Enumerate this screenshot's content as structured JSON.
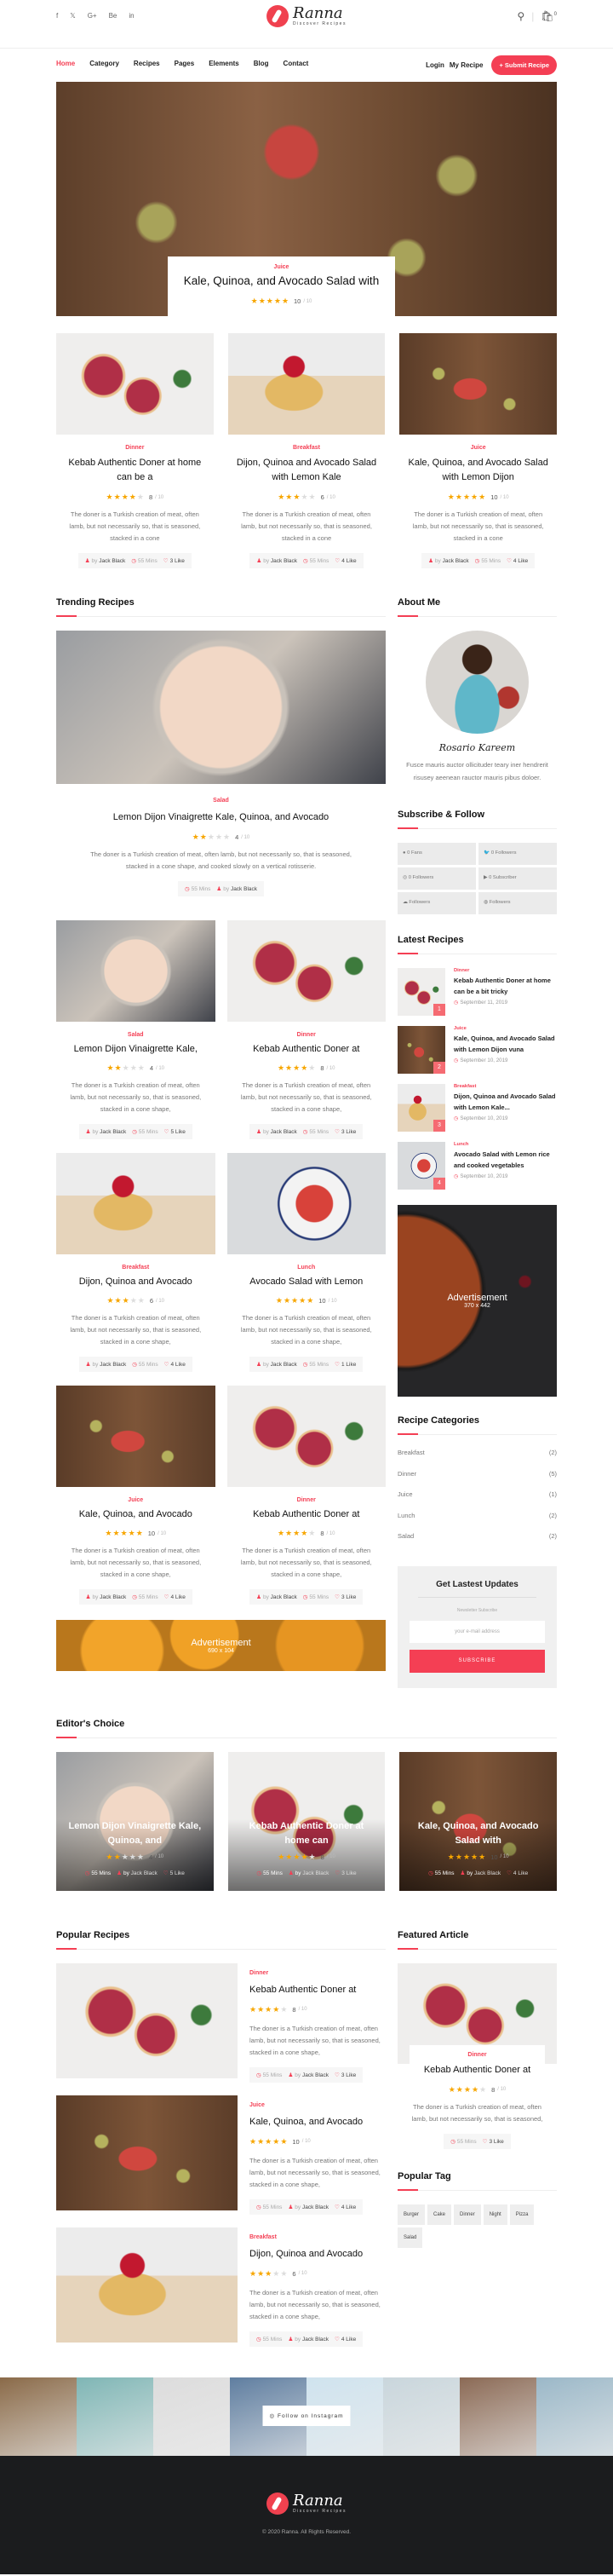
{
  "header": {
    "social": [
      "f",
      "𝕏",
      "G+",
      "Be",
      "in"
    ],
    "logo": {
      "name": "Ranna",
      "tagline": "Discover Recipes"
    },
    "search_icon": "search-icon",
    "cart_count": "0"
  },
  "nav": {
    "items": [
      "Home",
      "Category",
      "Recipes",
      "Pages",
      "Elements",
      "Blog",
      "Contact"
    ],
    "login": "Login",
    "my_recipe": "My Recipe",
    "submit": "Submit Recipe"
  },
  "common": {
    "by": "by",
    "author": "Jack Black",
    "time": "55 Mins",
    "rating_max": "/ 10"
  },
  "colors": {
    "accent": "#f43f54",
    "star": "#f7a600",
    "footer": "#1b1c1e"
  },
  "hero": {
    "category": "Juice",
    "title": "Kale, Quinoa, and Avocado Salad with",
    "rating": 10
  },
  "top_cards": [
    {
      "img": "pie",
      "category": "Dinner",
      "title": "Kebab Authentic Doner at home can be a",
      "rating": 8,
      "desc": "The doner is a Turkish creation of meat, often lamb, but not necessarily so, that is seasoned, stacked in a cone",
      "likes": "3 Like"
    },
    {
      "img": "waffle",
      "category": "Breakfast",
      "title": "Dijon, Quinoa and Avocado Salad with Lemon Kale",
      "rating": 6,
      "desc": "The doner is a Turkish creation of meat, often lamb, but not necessarily so, that is seasoned, stacked in a cone",
      "likes": "4 Like"
    },
    {
      "img": "juice",
      "category": "Juice",
      "title": "Kale, Quinoa, and Avocado Salad with Lemon Dijon",
      "rating": 10,
      "desc": "The doner is a Turkish creation of meat, often lamb, but not necessarily so, that is seasoned, stacked in a cone",
      "likes": "4 Like"
    }
  ],
  "trending": {
    "heading": "Trending Recipes",
    "main": {
      "img": "mac",
      "category": "Salad",
      "title": "Lemon Dijon Vinaigrette Kale, Quinoa, and Avocado",
      "rating": 4,
      "desc": "The doner is a Turkish creation of meat, often lamb, but not necessarily so, that is seasoned, stacked in a cone shape, and cooked slowly on a vertical rotisserie."
    },
    "grid": [
      {
        "img": "mac",
        "category": "Salad",
        "title": "Lemon Dijon Vinaigrette Kale,",
        "rating": 4,
        "desc": "The doner is a Turkish creation of meat, often lamb, but not necessarily so, that is seasoned, stacked in a cone shape,",
        "likes": "5 Like"
      },
      {
        "img": "pie",
        "category": "Dinner",
        "title": "Kebab Authentic Doner at",
        "rating": 8,
        "desc": "The doner is a Turkish creation of meat, often lamb, but not necessarily so, that is seasoned, stacked in a cone shape,",
        "likes": "3 Like"
      },
      {
        "img": "waffle",
        "category": "Breakfast",
        "title": "Dijon, Quinoa and Avocado",
        "rating": 6,
        "desc": "The doner is a Turkish creation of meat, often lamb, but not necessarily so, that is seasoned, stacked in a cone shape,",
        "likes": "4 Like"
      },
      {
        "img": "salad",
        "category": "Lunch",
        "title": "Avocado Salad with Lemon",
        "rating": 10,
        "desc": "The doner is a Turkish creation of meat, often lamb, but not necessarily so, that is seasoned, stacked in a cone shape,",
        "likes": "1 Like"
      },
      {
        "img": "juice",
        "category": "Juice",
        "title": "Kale, Quinoa, and Avocado",
        "rating": 10,
        "desc": "The doner is a Turkish creation of meat, often lamb, but not necessarily so, that is seasoned, stacked in a cone shape,",
        "likes": "4 Like"
      },
      {
        "img": "pie",
        "category": "Dinner",
        "title": "Kebab Authentic Doner at",
        "rating": 8,
        "desc": "The doner is a Turkish creation of meat, often lamb, but not necessarily so, that is seasoned, stacked in a cone shape,",
        "likes": "3 Like"
      }
    ],
    "ad": {
      "title": "Advertisement",
      "size": "690 x 104"
    }
  },
  "sidebar": {
    "about": {
      "heading": "About Me",
      "name": "Rosario Kareem",
      "text": "Fusce mauris auctor ollicituder teary iner hendrerit risusey aeenean rauctor mauris pibus doloer."
    },
    "follow": {
      "heading": "Subscribe & Follow",
      "items": [
        {
          "icon": "facebook-icon",
          "glyph": "●",
          "label": "0 Fans"
        },
        {
          "icon": "twitter-icon",
          "glyph": "🐦",
          "label": "0 Followers"
        },
        {
          "icon": "instagram-icon",
          "glyph": "◎",
          "label": "0 Followers"
        },
        {
          "icon": "youtube-icon",
          "glyph": "▶",
          "label": "0 Subscriber"
        },
        {
          "icon": "soundcloud-icon",
          "glyph": "☁",
          "label": "Followers"
        },
        {
          "icon": "dribbble-icon",
          "glyph": "◍",
          "label": "Followers"
        }
      ]
    },
    "latest": {
      "heading": "Latest Recipes",
      "items": [
        {
          "img": "pie",
          "num": "1",
          "category": "Dinner",
          "title": "Kebab Authentic Doner at home can be a bit tricky",
          "date": "September 11, 2019"
        },
        {
          "img": "juice",
          "num": "2",
          "category": "Juice",
          "title": "Kale, Quinoa, and Avocado Salad with Lemon Dijon vuna",
          "date": "September 10, 2019"
        },
        {
          "img": "waffle",
          "num": "3",
          "category": "Breakfast",
          "title": "Dijon, Quinoa and Avocado Salad with Lemon Kale...",
          "date": "September 10, 2019"
        },
        {
          "img": "salad",
          "num": "4",
          "category": "Lunch",
          "title": "Avocado Salad with Lemon rice and cooked vegetables",
          "date": "September 10, 2019"
        }
      ]
    },
    "ad": {
      "title": "Advertisement",
      "size": "370 x 442"
    },
    "categories": {
      "heading": "Recipe Categories",
      "items": [
        {
          "name": "Breakfast",
          "count": "(2)"
        },
        {
          "name": "Dinner",
          "count": "(5)"
        },
        {
          "name": "Juice",
          "count": "(1)"
        },
        {
          "name": "Lunch",
          "count": "(2)"
        },
        {
          "name": "Salad",
          "count": "(2)"
        }
      ]
    },
    "newsletter": {
      "heading": "Get Lastest Updates",
      "label": "Newsletter Subscribe",
      "placeholder": "your e-mail address",
      "button": "SUBSCRIBE"
    }
  },
  "editors": {
    "heading": "Editor's Choice",
    "items": [
      {
        "img": "mac",
        "title": "Lemon Dijon Vinaigrette Kale, Quinoa, and",
        "rating": 4,
        "likes": "5 Like"
      },
      {
        "img": "pie",
        "title": "Kebab Authentic Doner at home can",
        "rating": 8,
        "likes": "3 Like"
      },
      {
        "img": "juice",
        "title": "Kale, Quinoa, and Avocado Salad with",
        "rating": 10,
        "likes": "4 Like"
      }
    ]
  },
  "popular": {
    "heading": "Popular Recipes",
    "items": [
      {
        "img": "pie",
        "category": "Dinner",
        "title": "Kebab Authentic Doner at",
        "rating": 8,
        "desc": "The doner is a Turkish creation of meat, often lamb, but not necessarily so, that is seasoned, stacked in a cone shape,",
        "likes": "3 Like"
      },
      {
        "img": "juice",
        "category": "Juice",
        "title": "Kale, Quinoa, and Avocado",
        "rating": 10,
        "desc": "The doner is a Turkish creation of meat, often lamb, but not necessarily so, that is seasoned, stacked in a cone shape,",
        "likes": "4 Like"
      },
      {
        "img": "waffle",
        "category": "Breakfast",
        "title": "Dijon, Quinoa and Avocado",
        "rating": 6,
        "desc": "The doner is a Turkish creation of meat, often lamb, but not necessarily so, that is seasoned, stacked in a cone shape,",
        "likes": "4 Like"
      }
    ]
  },
  "featured": {
    "heading": "Featured Article",
    "img": "pie",
    "category": "Dinner",
    "title": "Kebab Authentic Doner at",
    "rating": 8,
    "desc": "The doner is a Turkish creation of meat, often lamb, but not necessarily so, that is seasoned,",
    "likes": "3 Like"
  },
  "tags": {
    "heading": "Popular Tag",
    "items": [
      "Burger",
      "Cake",
      "Dinner",
      "Night",
      "Pizza",
      "Salad"
    ]
  },
  "instagram": {
    "button": "Follow on Instagram",
    "tiles": [
      "#8a6a48",
      "#7fb6b5",
      "#dcdcdc",
      "#5f7ea0",
      "#cfe3ee",
      "#c9d6dc",
      "#8b6a55",
      "#9bb8c8"
    ]
  },
  "footer": {
    "copyright": "© 2020 Ranna. All Rights Reserved."
  }
}
